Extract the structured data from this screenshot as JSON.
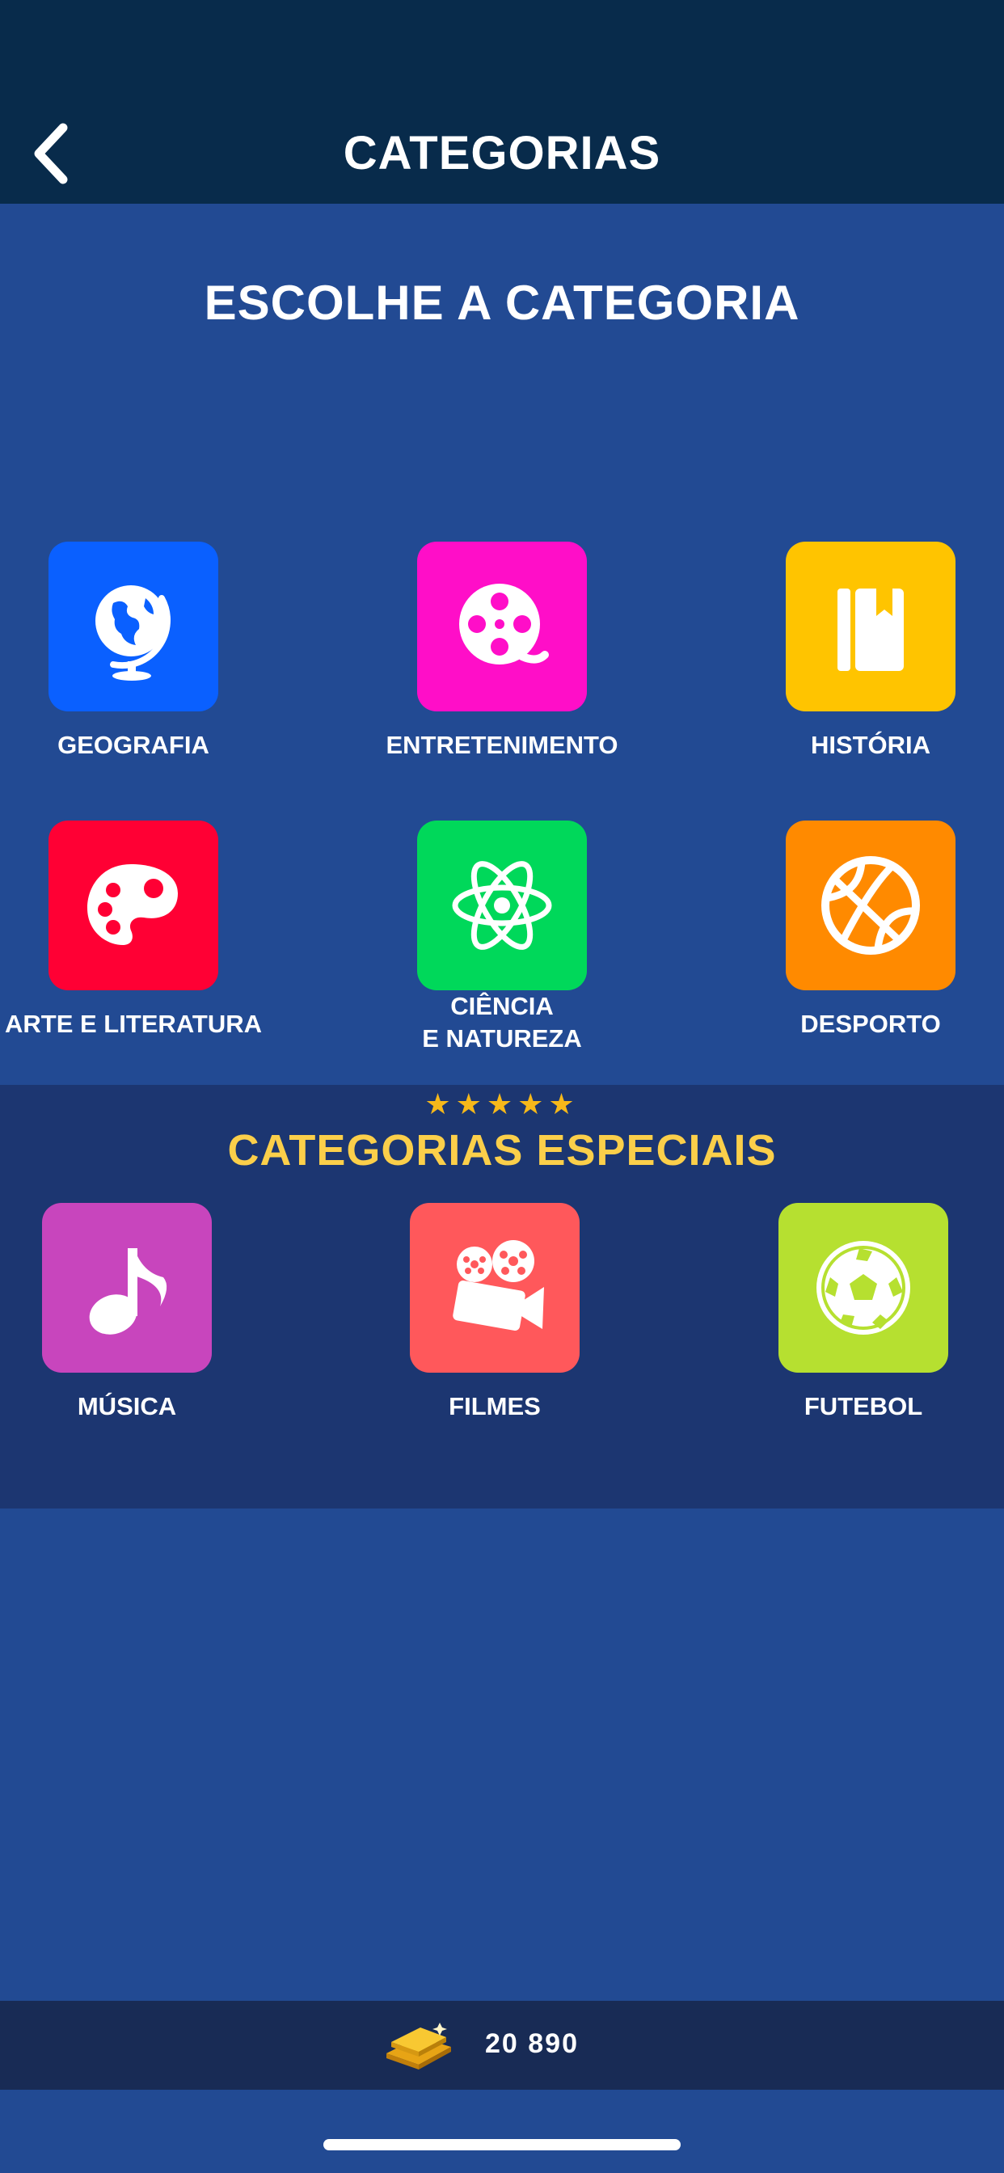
{
  "header": {
    "title": "CATEGORIAS",
    "back_icon": "chevron-left-icon"
  },
  "main": {
    "title": "ESCOLHE A CATEGORIA",
    "categories": [
      {
        "label": "GEOGRAFIA",
        "icon": "globe-icon",
        "color": "#0a60ff"
      },
      {
        "label": "ENTRETENIMENTO",
        "icon": "film-reel-icon",
        "color": "#ff0ec8"
      },
      {
        "label": "HISTÓRIA",
        "icon": "book-icon",
        "color": "#ffc400"
      },
      {
        "label": "ARTE E LITERATURA",
        "icon": "palette-icon",
        "color": "#ff0034"
      },
      {
        "label": "CIÊNCIA\nE NATUREZA",
        "icon": "atom-icon",
        "color": "#00d85a"
      },
      {
        "label": "DESPORTO",
        "icon": "basketball-icon",
        "color": "#ff8a00"
      }
    ]
  },
  "special": {
    "stars": "★★★★★",
    "stars_color": "#f6b81a",
    "title": "CATEGORIAS ESPECIAIS",
    "categories": [
      {
        "label": "MÚSICA",
        "icon": "music-note-icon",
        "color": "#c845bd"
      },
      {
        "label": "FILMES",
        "icon": "movie-camera-icon",
        "color": "#ff585b"
      },
      {
        "label": "FUTEBOL",
        "icon": "soccer-ball-icon",
        "color": "#b6e030"
      }
    ]
  },
  "footer": {
    "coins": "20 890",
    "coin_icon": "gold-bars-icon"
  }
}
